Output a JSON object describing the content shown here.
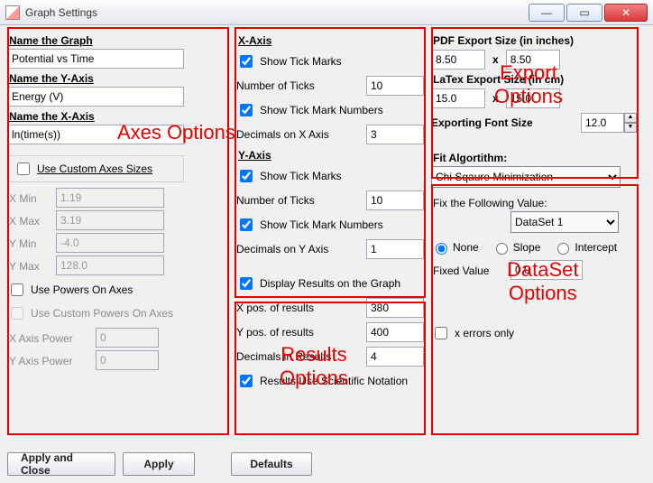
{
  "window": {
    "title": "Graph Settings"
  },
  "winctrl": {
    "min": "—",
    "max": "▭",
    "close": "✕"
  },
  "annotations": {
    "axes": "Axes Options",
    "results": "Results\nOptions",
    "export": "Export\nOptions",
    "dataset": "DataSet\nOptions"
  },
  "axes": {
    "name_graph_label": "Name the Graph",
    "name_graph_value": "Potential vs Time",
    "name_y_label": "Name the Y-Axis",
    "name_y_value": "Energy (V)",
    "name_x_label": "Name the X-Axis",
    "name_x_value": "ln(time(s))",
    "use_custom_sizes_label": "Use Custom Axes Sizes",
    "use_custom_sizes": false,
    "xmin_label": "X Min",
    "xmin_value": "1.19",
    "xmax_label": "X Max",
    "xmax_value": "3.19",
    "ymin_label": "Y Min",
    "ymin_value": "-4.0",
    "ymax_label": "Y Max",
    "ymax_value": "128.0",
    "use_powers_label": "Use Powers On Axes",
    "use_powers": false,
    "use_custom_powers_label": "Use Custom Powers On Axes",
    "use_custom_powers": false,
    "x_power_label": "X Axis Power",
    "x_power_value": "0",
    "y_power_label": "Y Axis Power",
    "y_power_value": "0"
  },
  "xaxis": {
    "header": "X-Axis",
    "show_ticks_label": "Show Tick Marks",
    "show_ticks": true,
    "num_ticks_label": "Number of Ticks",
    "num_ticks_value": "10",
    "show_tick_nums_label": "Show Tick Mark Numbers",
    "show_tick_nums": true,
    "decimals_label": "Decimals on X Axis",
    "decimals_value": "3"
  },
  "yaxis": {
    "header": "Y-Axis",
    "show_ticks_label": "Show Tick Marks",
    "show_ticks": true,
    "num_ticks_label": "Number of Ticks",
    "num_ticks_value": "10",
    "show_tick_nums_label": "Show Tick Mark Numbers",
    "show_tick_nums": true,
    "decimals_label": "Decimals on Y Axis",
    "decimals_value": "1"
  },
  "results": {
    "display_label": "Display Results on the Graph",
    "display": true,
    "xpos_label": "X pos. of results",
    "xpos_value": "380",
    "ypos_label": "Y pos. of results",
    "ypos_value": "400",
    "decimals_label": "Decimals in Results",
    "decimals_value": "4",
    "sci_label": "Results Use Scientific Notation",
    "sci": true
  },
  "export": {
    "pdf_label": "PDF Export Size (in inches)",
    "pdf_w": "8.50",
    "pdf_h": "8.50",
    "latex_label": "LaTex Export Size (in cm)",
    "latex_w": "15.0",
    "latex_h": "15.0",
    "font_label": "Exporting Font Size",
    "font_value": "12.0"
  },
  "dataset": {
    "fit_algo_label": "Fit Algortithm:",
    "fit_algo_value": "Chi Sqaure Minimization",
    "fix_label": "Fix the Following Value:",
    "dataset_value": "DataSet 1",
    "radio_none": "None",
    "radio_slope": "Slope",
    "radio_intercept": "Intercept",
    "fixed_label": "Fixed Value",
    "fixed_value": "0.0",
    "xerrors_label": "x errors only",
    "xerrors": false
  },
  "buttons": {
    "apply_close": "Apply and Close",
    "apply": "Apply",
    "defaults": "Defaults"
  },
  "glyph": {
    "times": "x"
  }
}
